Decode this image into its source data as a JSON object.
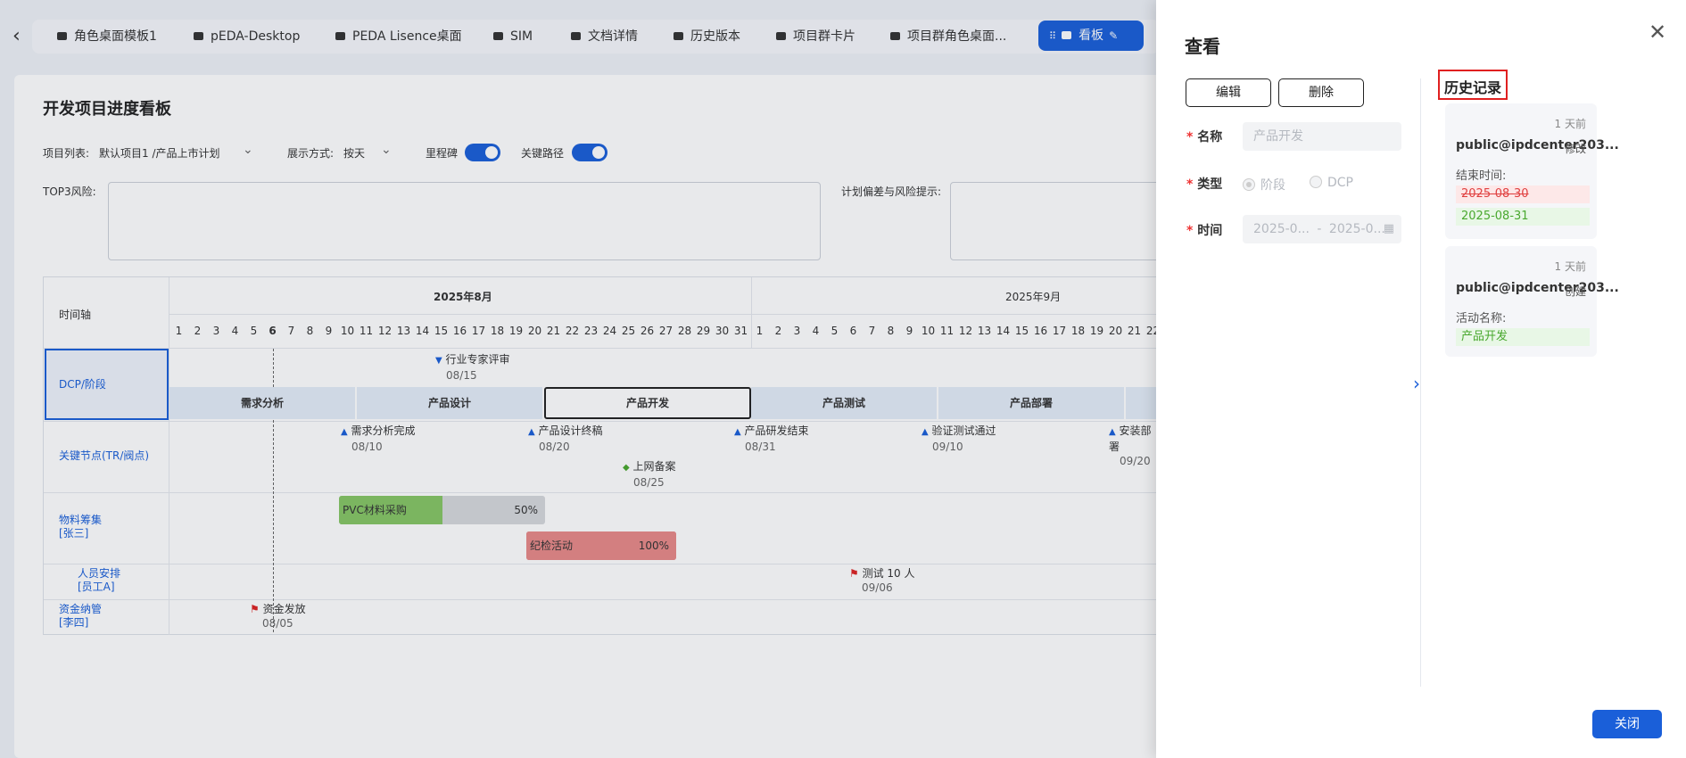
{
  "tabs": [
    {
      "label": "角色桌面模板1"
    },
    {
      "label": "pEDA-Desktop"
    },
    {
      "label": "PEDA Lisence桌面"
    },
    {
      "label": "SIM"
    },
    {
      "label": "文档详情"
    },
    {
      "label": "历史版本"
    },
    {
      "label": "项目群卡片"
    },
    {
      "label": "项目群角色桌面..."
    },
    {
      "label": "看板",
      "active": true
    }
  ],
  "board": {
    "title": "开发项目进度看板",
    "project_list_label": "项目列表:",
    "project_list_value": "默认项目1 /产品上市计划",
    "display_mode_label": "展示方式:",
    "display_mode_value": "按天",
    "milestone_label": "里程碑",
    "milestone_on": true,
    "critical_path_label": "关键路径",
    "critical_path_on": true,
    "top3_risk_label": "TOP3风险:",
    "deviation_label": "计划偏差与风险提示:"
  },
  "gantt": {
    "timeline_label": "时间轴",
    "months": [
      "2025年8月",
      "2025年9月"
    ],
    "aug_days": [
      "1",
      "2",
      "3",
      "4",
      "5",
      "6",
      "7",
      "8",
      "9",
      "10",
      "11",
      "12",
      "13",
      "14",
      "15",
      "16",
      "17",
      "18",
      "19",
      "20",
      "21",
      "22",
      "23",
      "24",
      "25",
      "26",
      "27",
      "28",
      "29",
      "30",
      "31"
    ],
    "sep_days": [
      "1",
      "2",
      "3",
      "4",
      "5",
      "6",
      "7",
      "8",
      "9",
      "10",
      "11",
      "12",
      "13",
      "14",
      "15",
      "16",
      "17",
      "18",
      "19",
      "20",
      "21",
      "22"
    ],
    "today_day": "6",
    "rows": {
      "dcp": "DCP/阶段",
      "key_nodes": "关键节点(TR/阀点)",
      "materials": "物料筹集\n[张三]",
      "staffing": "人员安排\n[员工A]",
      "funds": "资金纳管\n[李四]"
    },
    "dcp_milestone": {
      "name": "行业专家评审",
      "date": "08/15"
    },
    "stages": [
      {
        "label": "需求分析"
      },
      {
        "label": "产品设计"
      },
      {
        "label": "产品开发",
        "selected": true
      },
      {
        "label": "产品测试"
      },
      {
        "label": "产品部署"
      }
    ],
    "key_nodes": [
      {
        "name": "需求分析完成",
        "date": "08/10"
      },
      {
        "name": "产品设计终稿",
        "date": "08/20"
      },
      {
        "name": "产品研发结束",
        "date": "08/31"
      },
      {
        "name": "验证测试通过",
        "date": "09/10"
      },
      {
        "name": "安装部署",
        "date": "09/20"
      }
    ],
    "key_node_extra": {
      "name": "上网备案",
      "date": "08/25"
    },
    "material_tasks": [
      {
        "name": "PVC材料采购",
        "progress_label": "50%",
        "progress": 0.5,
        "color": "#86c665",
        "track": "#d6d8dc"
      },
      {
        "name": "纪检活动",
        "progress_label": "100%",
        "progress": 1.0,
        "color": "#e88a88",
        "track": "#e88a88"
      }
    ],
    "staffing_event": {
      "name": "测试 10 人",
      "date": "09/06"
    },
    "funds_event": {
      "name": "资金发放",
      "date": "08/05"
    }
  },
  "panel": {
    "title": "查看",
    "edit_label": "编辑",
    "delete_label": "删除",
    "name_label": "名称",
    "name_value": "产品开发",
    "type_label": "类型",
    "type_options": [
      {
        "label": "阶段",
        "checked": true
      },
      {
        "label": "DCP",
        "checked": false
      }
    ],
    "time_label": "时间",
    "time_start": "2025-0...",
    "time_sep": "-",
    "time_end": "2025-0...",
    "history_title": "历史记录",
    "history": [
      {
        "when": "1 天前",
        "user": "public@ipdcenter203...",
        "action": "修改",
        "field": "结束时间:",
        "old": "2025-08-30",
        "new": "2025-08-31"
      },
      {
        "when": "1 天前",
        "user": "public@ipdcenter203...",
        "action": "创建",
        "field": "活动名称:",
        "new": "产品开发"
      }
    ],
    "close_label": "关闭"
  }
}
